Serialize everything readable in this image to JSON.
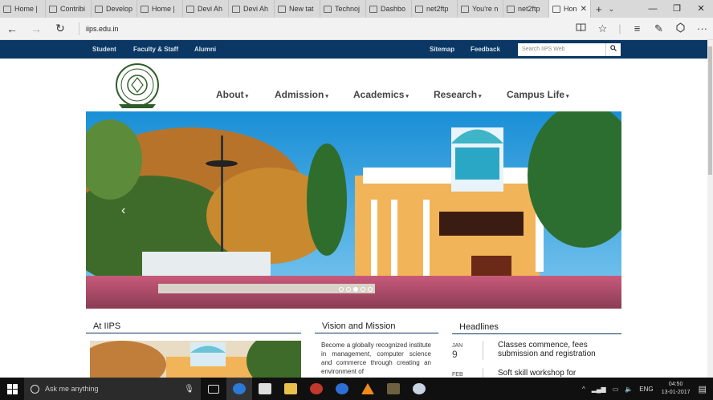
{
  "browser": {
    "tabs": [
      {
        "title": "Home |",
        "active": false
      },
      {
        "title": "Contribi",
        "active": false
      },
      {
        "title": "Develop",
        "active": false
      },
      {
        "title": "Home |",
        "active": false
      },
      {
        "title": "Devi Ah",
        "active": false
      },
      {
        "title": "Devi Ah",
        "active": false
      },
      {
        "title": "New tat",
        "active": false
      },
      {
        "title": "Technoj",
        "active": false
      },
      {
        "title": "Dashbo",
        "active": false
      },
      {
        "title": "net2ftp",
        "active": false
      },
      {
        "title": "You're n",
        "active": false
      },
      {
        "title": "net2ftp",
        "active": false
      },
      {
        "title": "Hon",
        "active": true
      }
    ],
    "new_tab": "+",
    "url": "iips.edu.in",
    "window_controls": {
      "minimize": "—",
      "restore": "❐",
      "close": "✕"
    },
    "nav_icons": {
      "back": "←",
      "forward": "→",
      "refresh": "↻"
    },
    "toolbar_icons": {
      "reading": "📖",
      "favorite": "☆",
      "hub": "≡",
      "notes": "✎",
      "share": "⛭",
      "more": "···"
    }
  },
  "site": {
    "topbar": {
      "links": [
        "Student",
        "Faculty & Staff",
        "Alumni"
      ],
      "right_links": [
        "Sitemap",
        "Feedback"
      ],
      "search_placeholder": "Search IIPS Web",
      "search_icon": "magnifier-icon"
    },
    "nav": [
      {
        "label": "About"
      },
      {
        "label": "Admission"
      },
      {
        "label": "Academics"
      },
      {
        "label": "Research"
      },
      {
        "label": "Campus Life"
      }
    ],
    "caret": "▾",
    "slider": {
      "dots": 5,
      "active_dot": 3
    },
    "sections": {
      "at_iips": "At IIPS",
      "vision": "Vision and Mission",
      "vision_text": "Become a globally recognized institute in management, computer science and commerce through creating an environment of",
      "headlines_title": "Headlines",
      "headlines": [
        {
          "month": "JAN",
          "day": "9",
          "text": "Classes commence, fees submission and registration"
        },
        {
          "month": "FEB",
          "day": "",
          "text": "Soft skill workshop for"
        }
      ]
    },
    "colors": {
      "navy": "#0a3763"
    }
  },
  "taskbar": {
    "search_placeholder": "Ask me anything",
    "language": "ENG",
    "time": "04:50",
    "date": "13-01-2017"
  }
}
